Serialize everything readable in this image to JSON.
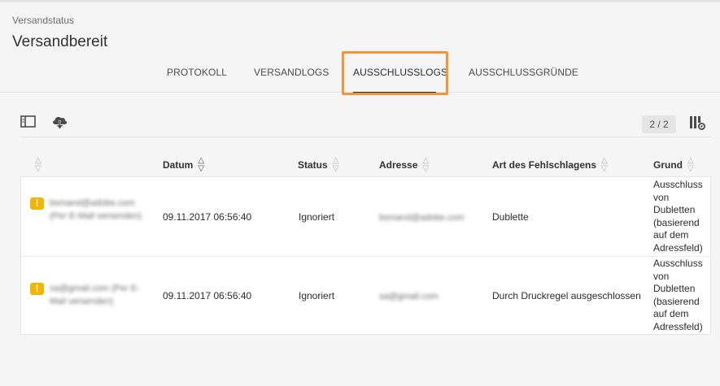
{
  "breadcrumb": "Versandstatus",
  "page_title": "Versandbereit",
  "tabs": [
    {
      "label": "PROTOKOLL"
    },
    {
      "label": "VERSANDLOGS"
    },
    {
      "label": "AUSSCHLUSSLOGS",
      "active": true
    },
    {
      "label": "AUSSCHLUSSGRÜNDE"
    }
  ],
  "toolbar": {
    "page_count": "2 / 2",
    "icons": [
      "panel-toggle-icon",
      "cloud-download-icon",
      "column-settings-icon"
    ]
  },
  "table": {
    "columns": [
      "",
      "Datum",
      "Status",
      "Adresse",
      "Art des Fehlschlagens",
      "Grund"
    ],
    "rows": [
      {
        "recipient": "bsmand@adobe.com (Per E-Mail versenden)",
        "date": "09.11.2017 06:56:40",
        "status": "Ignoriert",
        "address": "bsmand@adobe.com",
        "failure_type": "Dublette",
        "reason": "Ausschluss von Dubletten (basierend auf dem Adressfeld)"
      },
      {
        "recipient": "sa@gmail.com (Per E-Mail versenden)",
        "date": "09.11.2017 06:56:40",
        "status": "Ignoriert",
        "address": "sa@gmail.com",
        "failure_type": "Durch Druckregel ausgeschlossen",
        "reason": "Ausschluss von Dubletten (basierend auf dem Adressfeld)"
      }
    ]
  },
  "colors": {
    "highlight": "#f1953d",
    "warning": "#f2b500"
  }
}
